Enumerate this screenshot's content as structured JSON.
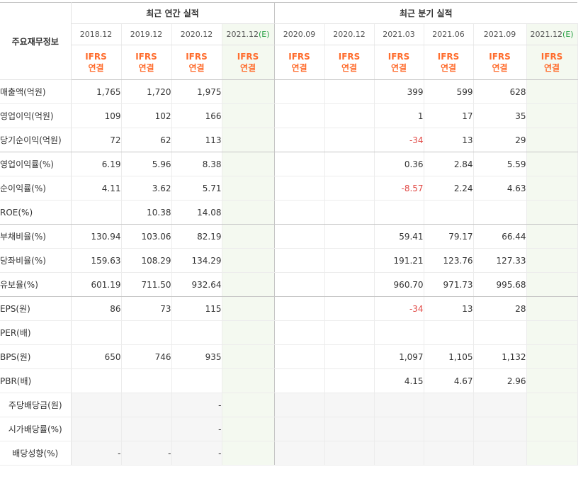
{
  "corner_label": "주요재무정보",
  "group_headers": {
    "annual": "최근 연간 실적",
    "quarterly": "최근 분기 실적"
  },
  "periods": [
    {
      "label": "2018.12",
      "std": "IFRS",
      "consol": "연결",
      "estimate": false
    },
    {
      "label": "2019.12",
      "std": "IFRS",
      "consol": "연결",
      "estimate": false
    },
    {
      "label": "2020.12",
      "std": "IFRS",
      "consol": "연결",
      "estimate": false
    },
    {
      "label": "2021.12",
      "suffix": "(E)",
      "std": "IFRS",
      "consol": "연결",
      "estimate": true
    },
    {
      "label": "2020.09",
      "std": "IFRS",
      "consol": "연결",
      "estimate": false
    },
    {
      "label": "2020.12",
      "std": "IFRS",
      "consol": "연결",
      "estimate": false
    },
    {
      "label": "2021.03",
      "std": "IFRS",
      "consol": "연결",
      "estimate": false
    },
    {
      "label": "2021.06",
      "std": "IFRS",
      "consol": "연결",
      "estimate": false
    },
    {
      "label": "2021.09",
      "std": "IFRS",
      "consol": "연결",
      "estimate": false
    },
    {
      "label": "2021.12",
      "suffix": "(E)",
      "std": "IFRS",
      "consol": "연결",
      "estimate": true
    }
  ],
  "rows": [
    {
      "label": "매출액(억원)",
      "values": [
        "1,765",
        "1,720",
        "1,975",
        "",
        "",
        "",
        "399",
        "599",
        "628",
        ""
      ]
    },
    {
      "label": "영업이익(억원)",
      "values": [
        "109",
        "102",
        "166",
        "",
        "",
        "",
        "1",
        "17",
        "35",
        ""
      ]
    },
    {
      "label": "당기순이익(억원)",
      "values": [
        "72",
        "62",
        "113",
        "",
        "",
        "",
        "-34",
        "13",
        "29",
        ""
      ]
    },
    {
      "label": "영업이익률(%)",
      "values": [
        "6.19",
        "5.96",
        "8.38",
        "",
        "",
        "",
        "0.36",
        "2.84",
        "5.59",
        ""
      ]
    },
    {
      "label": "순이익률(%)",
      "values": [
        "4.11",
        "3.62",
        "5.71",
        "",
        "",
        "",
        "-8.57",
        "2.24",
        "4.63",
        ""
      ]
    },
    {
      "label": "ROE(%)",
      "values": [
        "",
        "10.38",
        "14.08",
        "",
        "",
        "",
        "",
        "",
        "",
        ""
      ]
    },
    {
      "label": "부채비율(%)",
      "values": [
        "130.94",
        "103.06",
        "82.19",
        "",
        "",
        "",
        "59.41",
        "79.17",
        "66.44",
        ""
      ]
    },
    {
      "label": "당좌비율(%)",
      "values": [
        "159.63",
        "108.29",
        "134.29",
        "",
        "",
        "",
        "191.21",
        "123.76",
        "127.33",
        ""
      ]
    },
    {
      "label": "유보율(%)",
      "values": [
        "601.19",
        "711.50",
        "932.64",
        "",
        "",
        "",
        "960.70",
        "971.73",
        "995.68",
        ""
      ]
    },
    {
      "label": "EPS(원)",
      "values": [
        "86",
        "73",
        "115",
        "",
        "",
        "",
        "-34",
        "13",
        "28",
        ""
      ]
    },
    {
      "label": "PER(배)",
      "values": [
        "",
        "",
        "",
        "",
        "",
        "",
        "",
        "",
        "",
        ""
      ]
    },
    {
      "label": "BPS(원)",
      "values": [
        "650",
        "746",
        "935",
        "",
        "",
        "",
        "1,097",
        "1,105",
        "1,132",
        ""
      ]
    },
    {
      "label": "PBR(배)",
      "values": [
        "",
        "",
        "",
        "",
        "",
        "",
        "4.15",
        "4.67",
        "2.96",
        ""
      ]
    },
    {
      "label": "주당배당금(원)",
      "values": [
        "",
        "",
        "-",
        "",
        "",
        "",
        "",
        "",
        "",
        ""
      ]
    },
    {
      "label": "시가배당률(%)",
      "values": [
        "",
        "",
        "-",
        "",
        "",
        "",
        "",
        "",
        "",
        ""
      ]
    },
    {
      "label": "배당성향(%)",
      "values": [
        "-",
        "-",
        "-",
        "",
        "",
        "",
        "",
        "",
        "",
        ""
      ]
    }
  ],
  "group_end_rows": [
    2,
    5,
    8
  ],
  "gray_rows": [
    13,
    14,
    15
  ],
  "center_label_rows": [
    13,
    14,
    15
  ],
  "colors": {
    "accent_orange": "#ff6d2e",
    "estimate_green": "#2aa146",
    "negative_red": "#e14a46",
    "estimate_bg": "#f4f9f0"
  }
}
